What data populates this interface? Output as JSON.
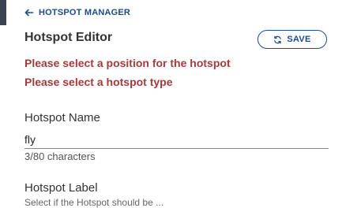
{
  "nav": {
    "back_label": "HOTSPOT MANAGER"
  },
  "editor": {
    "title": "Hotspot Editor",
    "save_label": "SAVE",
    "errors": [
      "Please select a position for the hotspot",
      "Please select a hotspot type"
    ]
  },
  "form": {
    "name": {
      "label": "Hotspot Name",
      "value": "fly",
      "char_count": "3/80 characters"
    },
    "hotspot_label": {
      "label": "Hotspot Label",
      "helper_text": "Select if the Hotspot should be ..."
    }
  },
  "colors": {
    "accent": "#1a4a8f",
    "error": "#a33b3b"
  }
}
